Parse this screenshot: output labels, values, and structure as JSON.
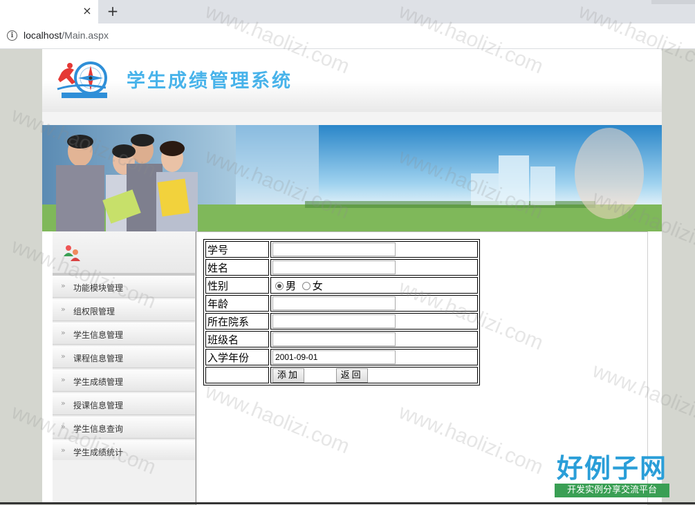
{
  "browser": {
    "tab_close": "×",
    "new_tab": "+",
    "url_host": "localhost",
    "url_path": "/Main.aspx",
    "info_icon": "i"
  },
  "header": {
    "title": "学生成绩管理系统"
  },
  "sidebar": {
    "items": [
      {
        "label": "功能模块管理"
      },
      {
        "label": "组权限管理"
      },
      {
        "label": "学生信息管理"
      },
      {
        "label": "课程信息管理"
      },
      {
        "label": "学生成绩管理"
      },
      {
        "label": "授课信息管理"
      },
      {
        "label": "学生信息查询"
      },
      {
        "label": "学生成绩统计"
      }
    ],
    "arrow": "»"
  },
  "form": {
    "student_id": {
      "label": "学号",
      "value": ""
    },
    "name": {
      "label": "姓名",
      "value": ""
    },
    "gender": {
      "label": "性别",
      "options": [
        "男",
        "女"
      ],
      "selected": "男"
    },
    "age": {
      "label": "年龄",
      "value": ""
    },
    "department": {
      "label": "所在院系",
      "value": ""
    },
    "class_name": {
      "label": "班级名",
      "value": ""
    },
    "enroll_year": {
      "label": "入学年份",
      "value": "2001-09-01"
    },
    "add_button": "添加",
    "back_button": "返回"
  },
  "watermark": {
    "text": "www.haolizi.com",
    "brand_name": "好例子网",
    "brand_sub": "开发实例分享交流平台"
  }
}
